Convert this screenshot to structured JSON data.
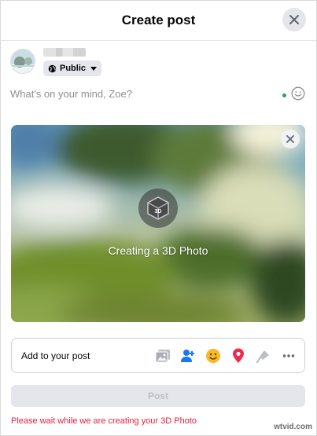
{
  "dialog": {
    "title": "Create post",
    "close_icon": "close-icon"
  },
  "user": {
    "avatar_icon": "avatar-photo",
    "privacy_label": "Public",
    "privacy_icon": "globe-icon"
  },
  "composer": {
    "placeholder": "What's on your mind, Zoe?",
    "emoji_icon": "smiley-icon",
    "status_color": "#31a24c"
  },
  "photo": {
    "badge_text": "3D",
    "status_text": "Creating a 3D Photo",
    "remove_icon": "close-icon"
  },
  "add_to_post": {
    "label": "Add to your post",
    "icons": [
      "photo-video-icon",
      "tag-people-icon",
      "feeling-icon",
      "check-in-icon",
      "microphone-icon",
      "more-icon"
    ]
  },
  "post_button": {
    "label": "Post",
    "enabled": false
  },
  "notice": {
    "text": "Please wait while we are creating your 3D Photo",
    "color": "#e41e3f"
  },
  "watermark": {
    "text": "wtvid.com"
  }
}
